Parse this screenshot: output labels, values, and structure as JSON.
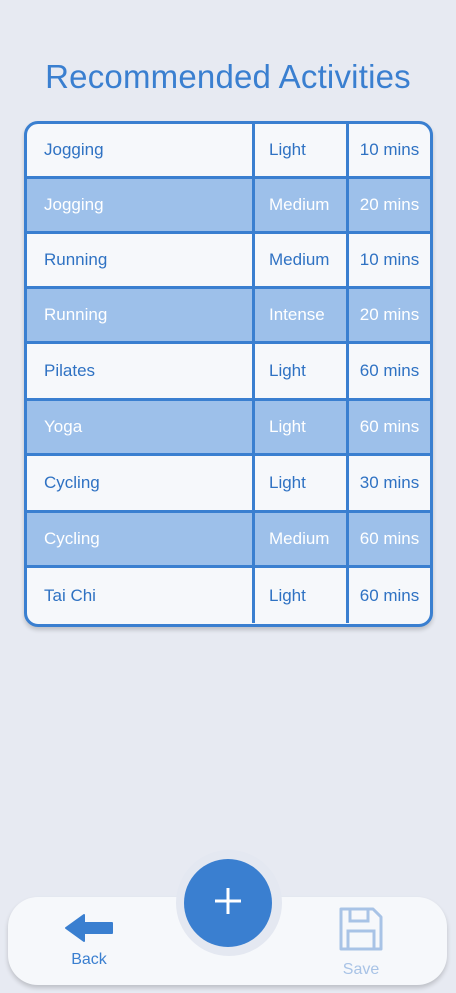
{
  "title": "Recommended Activities",
  "activities": [
    {
      "name": "Jogging",
      "level": "Light",
      "duration": "10 mins"
    },
    {
      "name": "Jogging",
      "level": "Medium",
      "duration": "20 mins"
    },
    {
      "name": "Running",
      "level": "Medium",
      "duration": "10 mins"
    },
    {
      "name": "Running",
      "level": "Intense",
      "duration": "20 mins"
    },
    {
      "name": "Pilates",
      "level": "Light",
      "duration": "60 mins"
    },
    {
      "name": "Yoga",
      "level": "Light",
      "duration": "60 mins"
    },
    {
      "name": "Cycling",
      "level": "Light",
      "duration": "30 mins"
    },
    {
      "name": "Cycling",
      "level": "Medium",
      "duration": "60 mins"
    },
    {
      "name": "Tai Chi",
      "level": "Light",
      "duration": "60 mins"
    }
  ],
  "bottom_nav": {
    "back_label": "Back",
    "back_icon": "arrow-left-icon",
    "add_icon": "plus-icon",
    "save_label": "Save",
    "save_icon": "floppy-disk-icon"
  },
  "colors": {
    "accent": "#3a7fd0",
    "row_highlight": "#9dc0ea",
    "background": "#e7eaf2",
    "save_disabled": "#a8c3e6"
  }
}
